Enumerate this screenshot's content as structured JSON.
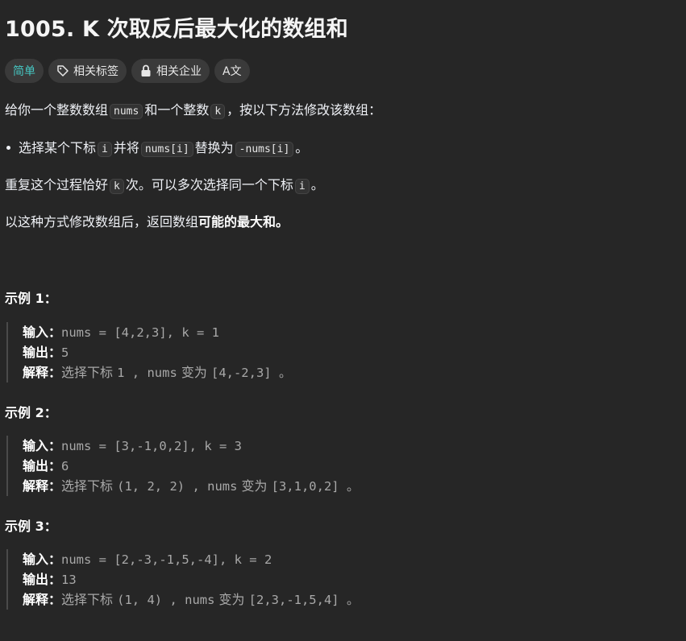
{
  "title": "1005. K 次取反后最大化的数组和",
  "tags": {
    "difficulty": "简单",
    "topics": "相关标签",
    "companies": "相关企业",
    "translate": "A文"
  },
  "desc": {
    "p1_a": "给你一个整数数组",
    "p1_code1": "nums",
    "p1_b": "和一个整数",
    "p1_code2": "k",
    "p1_c": "，按以下方法修改该数组：",
    "b1_a": "选择某个下标",
    "b1_code1": "i",
    "b1_b": "并将",
    "b1_code2": "nums[i]",
    "b1_c": "替换为",
    "b1_code3": "-nums[i]",
    "b1_d": "。",
    "p2_a": "重复这个过程恰好",
    "p2_code1": "k",
    "p2_b": "次。可以多次选择同一个下标",
    "p2_code2": "i",
    "p2_c": "。",
    "p3_a": "以这种方式修改数组后，返回数组",
    "p3_bold": "可能的最大和",
    "p3_b": "。"
  },
  "examples": [
    {
      "heading": "示例 1：",
      "input_label": "输入：",
      "input": "nums = [4,2,3], k = 1",
      "output_label": "输出：",
      "output": "5",
      "explain_label": "解释：",
      "explain_a": "选择下标",
      "explain_b": "1 , nums",
      "explain_c": "变为",
      "explain_d": "[4,-2,3] 。"
    },
    {
      "heading": "示例 2：",
      "input_label": "输入：",
      "input": "nums = [3,-1,0,2], k = 3",
      "output_label": "输出：",
      "output": "6",
      "explain_label": "解释：",
      "explain_a": "选择下标",
      "explain_b": "(1, 2, 2) , nums",
      "explain_c": "变为",
      "explain_d": "[3,1,0,2] 。"
    },
    {
      "heading": "示例 3：",
      "input_label": "输入：",
      "input": "nums = [2,-3,-1,5,-4], k = 2",
      "output_label": "输出：",
      "output": "13",
      "explain_label": "解释：",
      "explain_a": "选择下标",
      "explain_b": "(1, 4) , nums",
      "explain_c": "变为",
      "explain_d": "[2,3,-1,5,4] 。"
    }
  ]
}
